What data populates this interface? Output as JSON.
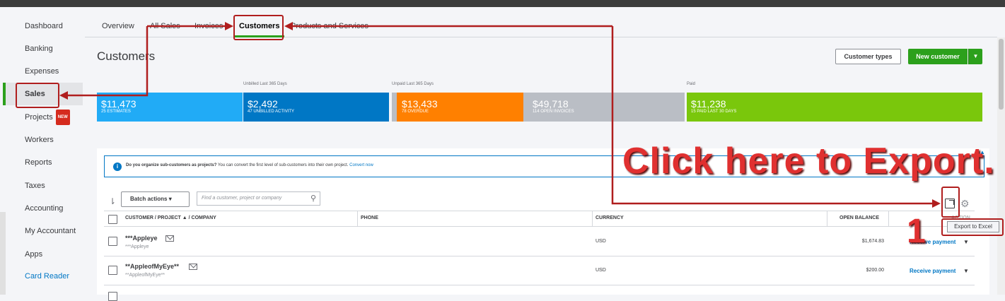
{
  "sidebar": {
    "items": [
      {
        "label": "Dashboard"
      },
      {
        "label": "Banking"
      },
      {
        "label": "Expenses"
      },
      {
        "label": "Sales"
      },
      {
        "label": "Projects",
        "badge": "NEW"
      },
      {
        "label": "Workers"
      },
      {
        "label": "Reports"
      },
      {
        "label": "Taxes"
      },
      {
        "label": "Accounting"
      },
      {
        "label": "My Accountant"
      },
      {
        "label": "Apps"
      },
      {
        "label": "Card Reader"
      }
    ]
  },
  "tabs": [
    {
      "label": "Overview"
    },
    {
      "label": "All Sales"
    },
    {
      "label": "Invoices"
    },
    {
      "label": "Customers"
    },
    {
      "label": "Products and Services"
    }
  ],
  "header": {
    "title": "Customers",
    "customer_types_label": "Customer types",
    "new_customer_label": "New customer",
    "caret": "▼"
  },
  "money_bar": {
    "labels": {
      "unbilled": "Unbilled Last 365 Days",
      "unpaid": "Unpaid Last 365 Days",
      "paid": "Paid"
    },
    "segments": [
      {
        "amount": "$11,473",
        "sub": "25 ESTIMATES",
        "color": "#21abf6"
      },
      {
        "amount": "$2,492",
        "sub": "47 UNBILLED ACTIVITY",
        "color": "#0077c5"
      },
      {
        "amount": "$13,433",
        "sub": "78 OVERDUE",
        "color": "#ff8000"
      },
      {
        "amount": "$49,718",
        "sub": "114 OPEN INVOICES",
        "color": "#babec5"
      },
      {
        "amount": "$11,238",
        "sub": "15 PAID LAST 30 DAYS",
        "color": "#7ac70c"
      }
    ]
  },
  "info": {
    "question": "Do you organize sub-customers as projects?",
    "text": " You can convert the first level of sub-customers into their own project. ",
    "link": "Convert now"
  },
  "toolbar": {
    "batch_label": "Batch actions",
    "search_placeholder": "Find a customer, project or company",
    "export_tooltip": "Export to Excel"
  },
  "table": {
    "columns": {
      "customer": "CUSTOMER / PROJECT ▲ / COMPANY",
      "phone": "PHONE",
      "currency": "CURRENCY",
      "open_balance": "OPEN BALANCE",
      "action": "ACTION"
    },
    "rows": [
      {
        "name": "***Appleye",
        "company": "***Appleye",
        "currency": "USD",
        "balance": "$1,674.83",
        "action": "Receive payment"
      },
      {
        "name": "**AppleofMyEye**",
        "company": "**AppleofMyEye**",
        "currency": "USD",
        "balance": "$200.00",
        "action": "Receive payment"
      }
    ]
  },
  "annotation": {
    "callout": "Click here to Export.",
    "step": "1"
  },
  "colors": {
    "accent_green": "#2ca01c",
    "link_blue": "#0077c5",
    "annotation_red": "#b01e1e"
  }
}
